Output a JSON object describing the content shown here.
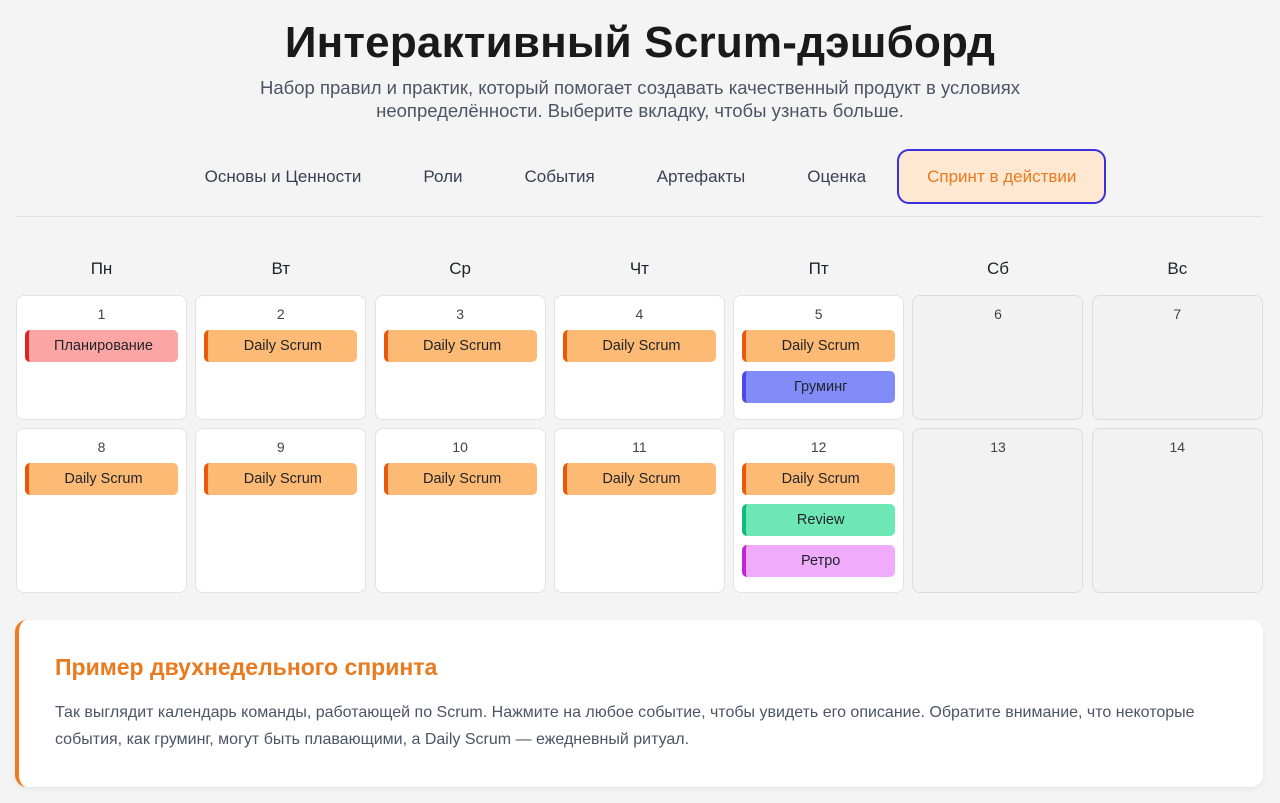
{
  "header": {
    "title": "Интерактивный Scrum-дэшборд",
    "subtitle": "Набор правил и практик, который помогает создавать качественный продукт в условиях неопределённости. Выберите вкладку, чтобы узнать больше."
  },
  "tabs": [
    {
      "label": "Основы и Ценности",
      "active": false
    },
    {
      "label": "Роли",
      "active": false
    },
    {
      "label": "События",
      "active": false
    },
    {
      "label": "Артефакты",
      "active": false
    },
    {
      "label": "Оценка",
      "active": false
    },
    {
      "label": "Спринт в действии",
      "active": true
    }
  ],
  "calendar": {
    "weekdays": [
      "Пн",
      "Вт",
      "Ср",
      "Чт",
      "Пт",
      "Сб",
      "Вс"
    ],
    "weeks": [
      {
        "days": [
          {
            "num": "1",
            "events": [
              {
                "label": "Планирование",
                "type": "planning"
              }
            ]
          },
          {
            "num": "2",
            "events": [
              {
                "label": "Daily Scrum",
                "type": "daily"
              }
            ]
          },
          {
            "num": "3",
            "events": [
              {
                "label": "Daily Scrum",
                "type": "daily"
              }
            ]
          },
          {
            "num": "4",
            "events": [
              {
                "label": "Daily Scrum",
                "type": "daily"
              }
            ]
          },
          {
            "num": "5",
            "events": [
              {
                "label": "Daily Scrum",
                "type": "daily"
              },
              {
                "label": "Груминг",
                "type": "grooming"
              }
            ]
          },
          {
            "num": "6",
            "weekend": true,
            "events": []
          },
          {
            "num": "7",
            "weekend": true,
            "events": []
          }
        ]
      },
      {
        "days": [
          {
            "num": "8",
            "events": [
              {
                "label": "Daily Scrum",
                "type": "daily"
              }
            ]
          },
          {
            "num": "9",
            "events": [
              {
                "label": "Daily Scrum",
                "type": "daily"
              }
            ]
          },
          {
            "num": "10",
            "events": [
              {
                "label": "Daily Scrum",
                "type": "daily"
              }
            ]
          },
          {
            "num": "11",
            "events": [
              {
                "label": "Daily Scrum",
                "type": "daily"
              }
            ]
          },
          {
            "num": "12",
            "events": [
              {
                "label": "Daily Scrum",
                "type": "daily"
              },
              {
                "label": "Review",
                "type": "review"
              },
              {
                "label": "Ретро",
                "type": "retro"
              }
            ]
          },
          {
            "num": "13",
            "weekend": true,
            "events": []
          },
          {
            "num": "14",
            "weekend": true,
            "events": []
          }
        ]
      }
    ]
  },
  "info": {
    "title": "Пример двухнедельного спринта",
    "text": "Так выглядит календарь команды, работающей по Scrum. Нажмите на любое событие, чтобы увидеть его описание. Обратите внимание, что некоторые события, как груминг, могут быть плавающими, а Daily Scrum — ежедневный ритуал."
  },
  "colors": {
    "accent": "#ea7a1e",
    "active_tab_bg": "#ffe8d2",
    "active_tab_border": "#3b30d9",
    "planning": "#fca5a5",
    "daily": "#fdba74",
    "grooming": "#818cf8",
    "review": "#6ee7b7",
    "retro": "#f0abfc"
  }
}
